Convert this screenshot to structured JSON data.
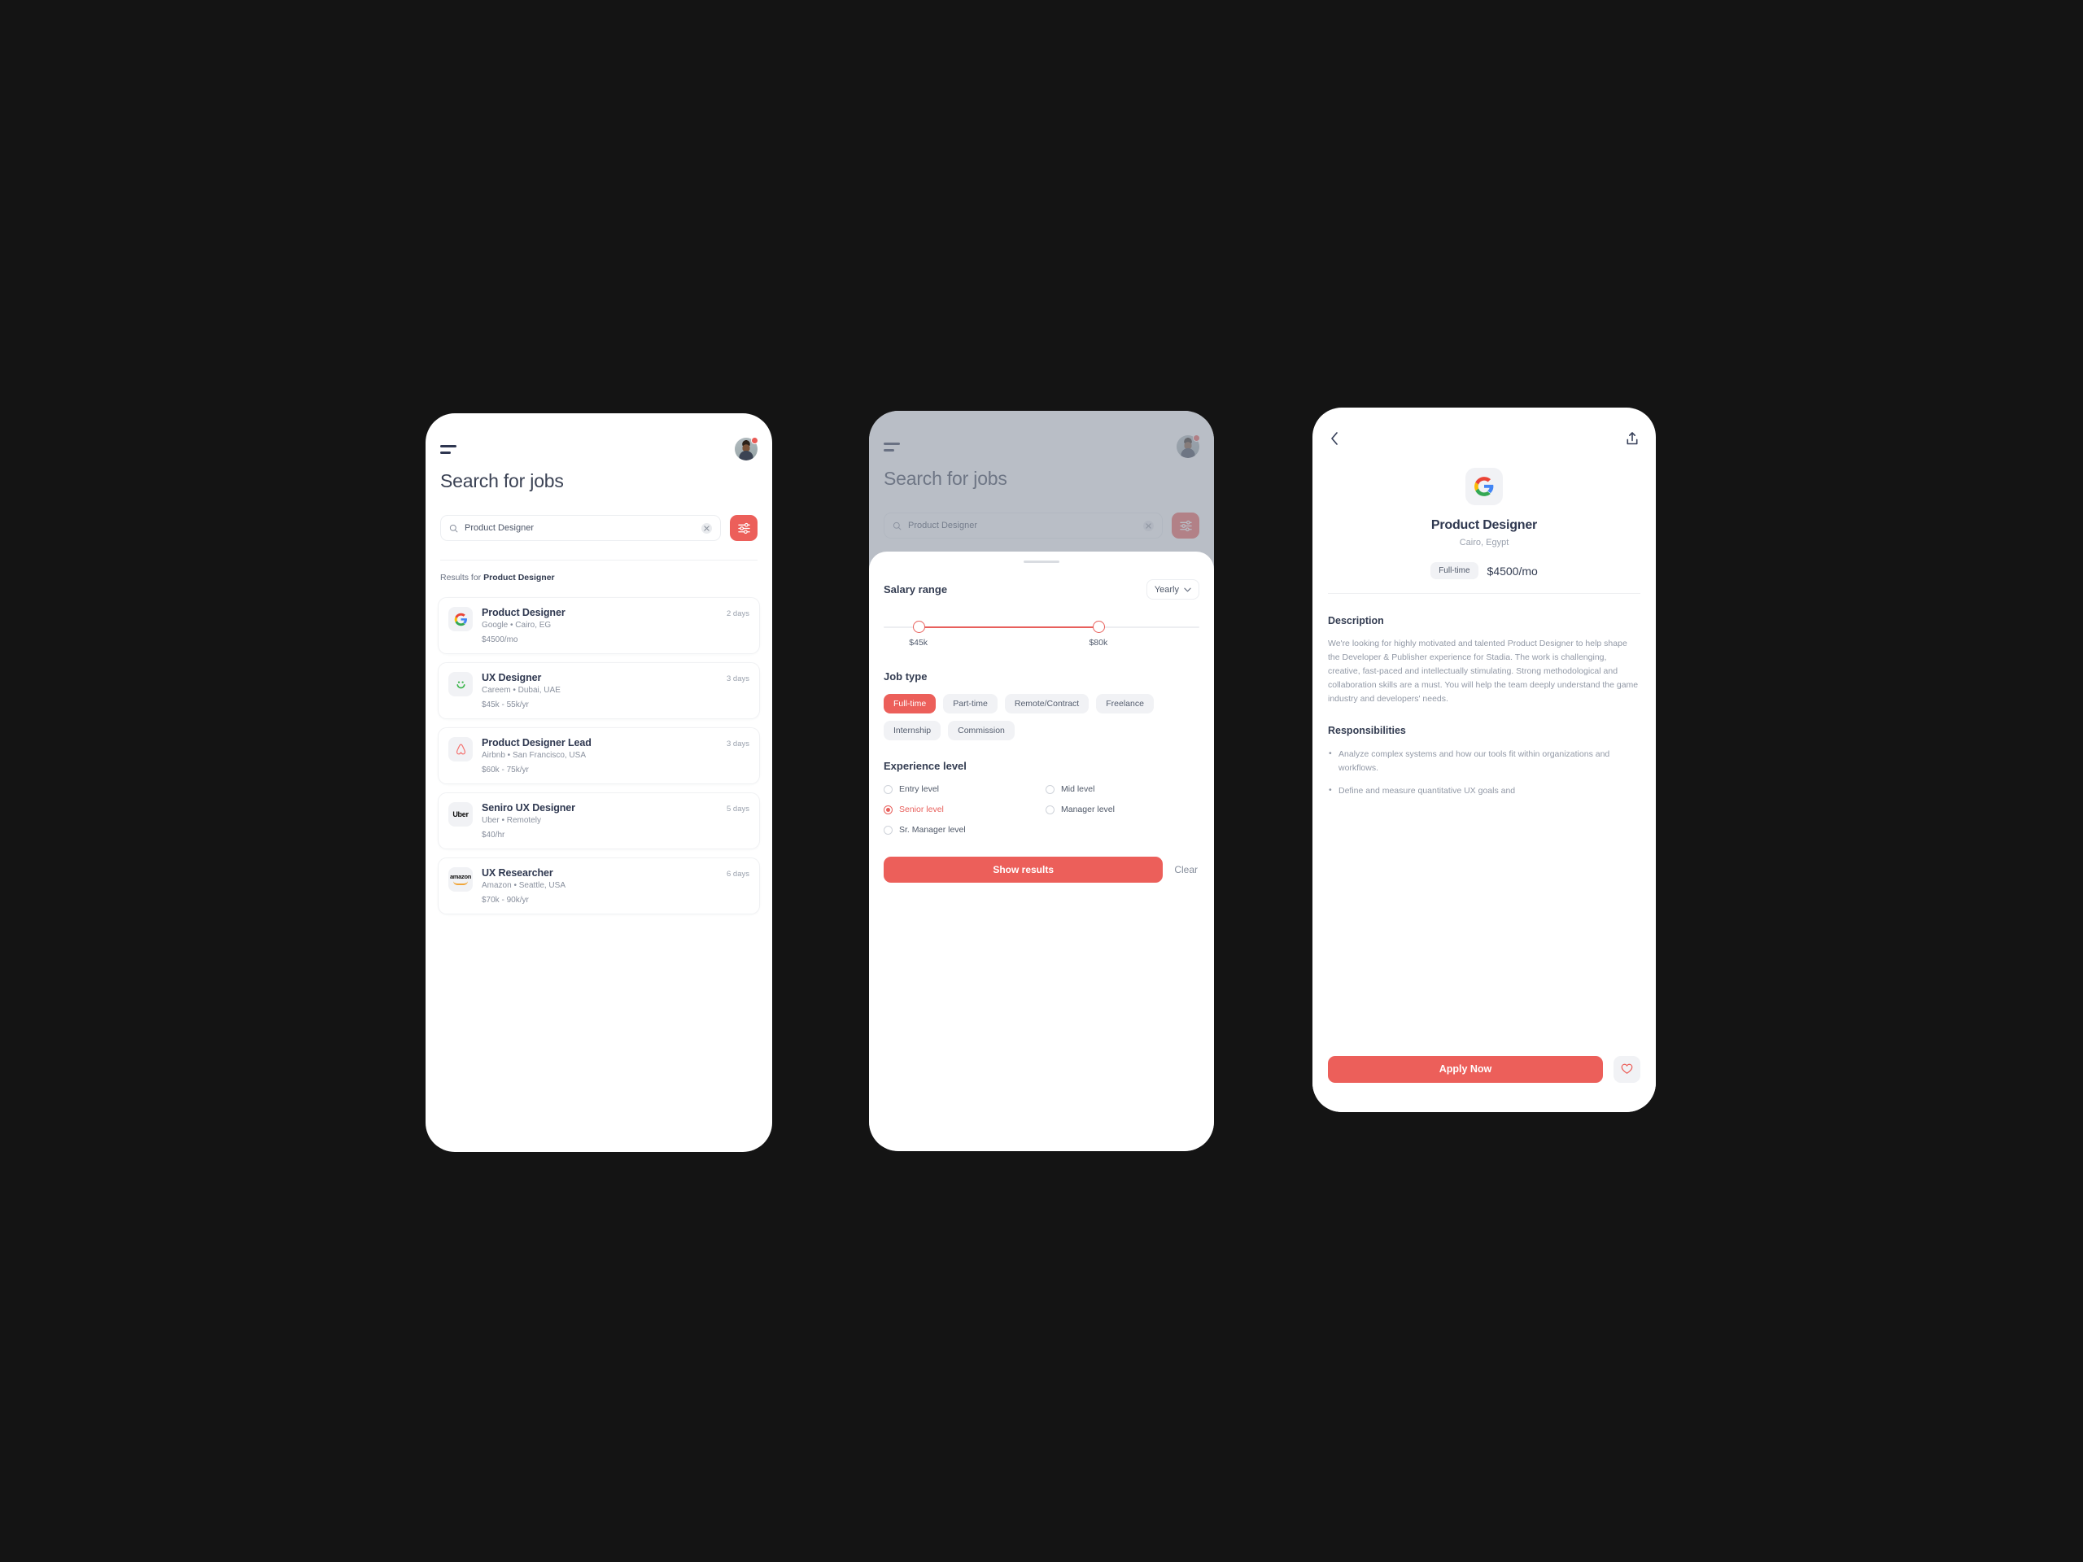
{
  "brand": {
    "accent": "#ec5f5a",
    "accent_dark": "#e8605c",
    "ink": "#2f3850",
    "muted": "#9299a6",
    "surface": "#f1f2f5"
  },
  "search_screen": {
    "menu_icon": "hamburger-icon",
    "avatar_icon": "user-avatar",
    "notification_badge": "",
    "title": "Search for jobs",
    "search": {
      "value": "Product Designer",
      "placeholder": "Search for jobs",
      "search_icon": "search-icon",
      "clear_icon": "close-icon"
    },
    "filter_icon": "sliders-icon",
    "results_prefix": "Results for ",
    "results_query": "Product Designer",
    "jobs": [
      {
        "title": "Product Designer",
        "age": "2 days",
        "meta": "Google • Cairo, EG",
        "pay": "$4500/mo",
        "logo": "google-logo"
      },
      {
        "title": "UX Designer",
        "age": "3 days",
        "meta": "Careem • Dubai, UAE",
        "pay": "$45k - 55k/yr",
        "logo": "careem-logo"
      },
      {
        "title": "Product Designer Lead",
        "age": "3 days",
        "meta": "Airbnb • San Francisco, USA",
        "pay": "$60k - 75k/yr",
        "logo": "airbnb-logo"
      },
      {
        "title": "Seniro UX Designer",
        "age": "5 days",
        "meta": "Uber • Remotely",
        "pay": "$40/hr",
        "logo": "uber-logo"
      },
      {
        "title": "UX Researcher",
        "age": "6 days",
        "meta": "Amazon • Seattle, USA",
        "pay": "$70k - 90k/yr",
        "logo": "amazon-logo"
      }
    ]
  },
  "filter_screen": {
    "menu_icon": "hamburger-icon",
    "avatar_icon": "user-avatar",
    "title": "Search for jobs",
    "search": {
      "value": "Product Designer",
      "placeholder": "Search for jobs",
      "search_icon": "search-icon",
      "clear_icon": "close-icon"
    },
    "filter_icon": "sliders-icon",
    "sheet": {
      "grabber": "drag-handle",
      "salary": {
        "heading": "Salary range",
        "period_value": "Yearly",
        "period_chevron": "chevron-down-icon",
        "min_label": "$45k",
        "max_label": "$80k",
        "min_value": 45000,
        "max_value": 80000
      },
      "job_type": {
        "heading": "Job type",
        "options": [
          {
            "label": "Full-time",
            "selected": true
          },
          {
            "label": "Part-time",
            "selected": false
          },
          {
            "label": "Remote/Contract",
            "selected": false
          },
          {
            "label": "Freelance",
            "selected": false
          },
          {
            "label": "Internship",
            "selected": false
          },
          {
            "label": "Commission",
            "selected": false
          }
        ]
      },
      "experience": {
        "heading": "Experience level",
        "options": [
          {
            "label": "Entry level",
            "selected": false
          },
          {
            "label": "Mid level",
            "selected": false
          },
          {
            "label": "Senior level",
            "selected": true
          },
          {
            "label": "Manager level",
            "selected": false
          },
          {
            "label": "Sr. Manager level",
            "selected": false
          }
        ]
      },
      "submit_label": "Show results",
      "clear_label": "Clear"
    }
  },
  "detail_screen": {
    "back_icon": "chevron-left-icon",
    "share_icon": "share-icon",
    "company_logo": "google-logo",
    "title": "Product Designer",
    "location": "Cairo, Egypt",
    "type_chip": "Full-time",
    "pay": "$4500/mo",
    "description_heading": "Description",
    "description_body": "We're looking for highly motivated and talented Product Designer to help shape the Developer & Publisher experience for Stadia. The work is challenging, creative, fast-paced and intellectually stimulating. Strong methodological and collaboration skills are a must. You will help the team deeply understand the game industry and developers' needs.",
    "responsibilities_heading": "Responsibilities",
    "responsibilities": [
      "Analyze complex systems and how our tools fit within organizations and workflows.",
      "Define and measure quantitative UX goals and"
    ],
    "apply_label": "Apply Now",
    "favorite_icon": "heart-icon"
  }
}
